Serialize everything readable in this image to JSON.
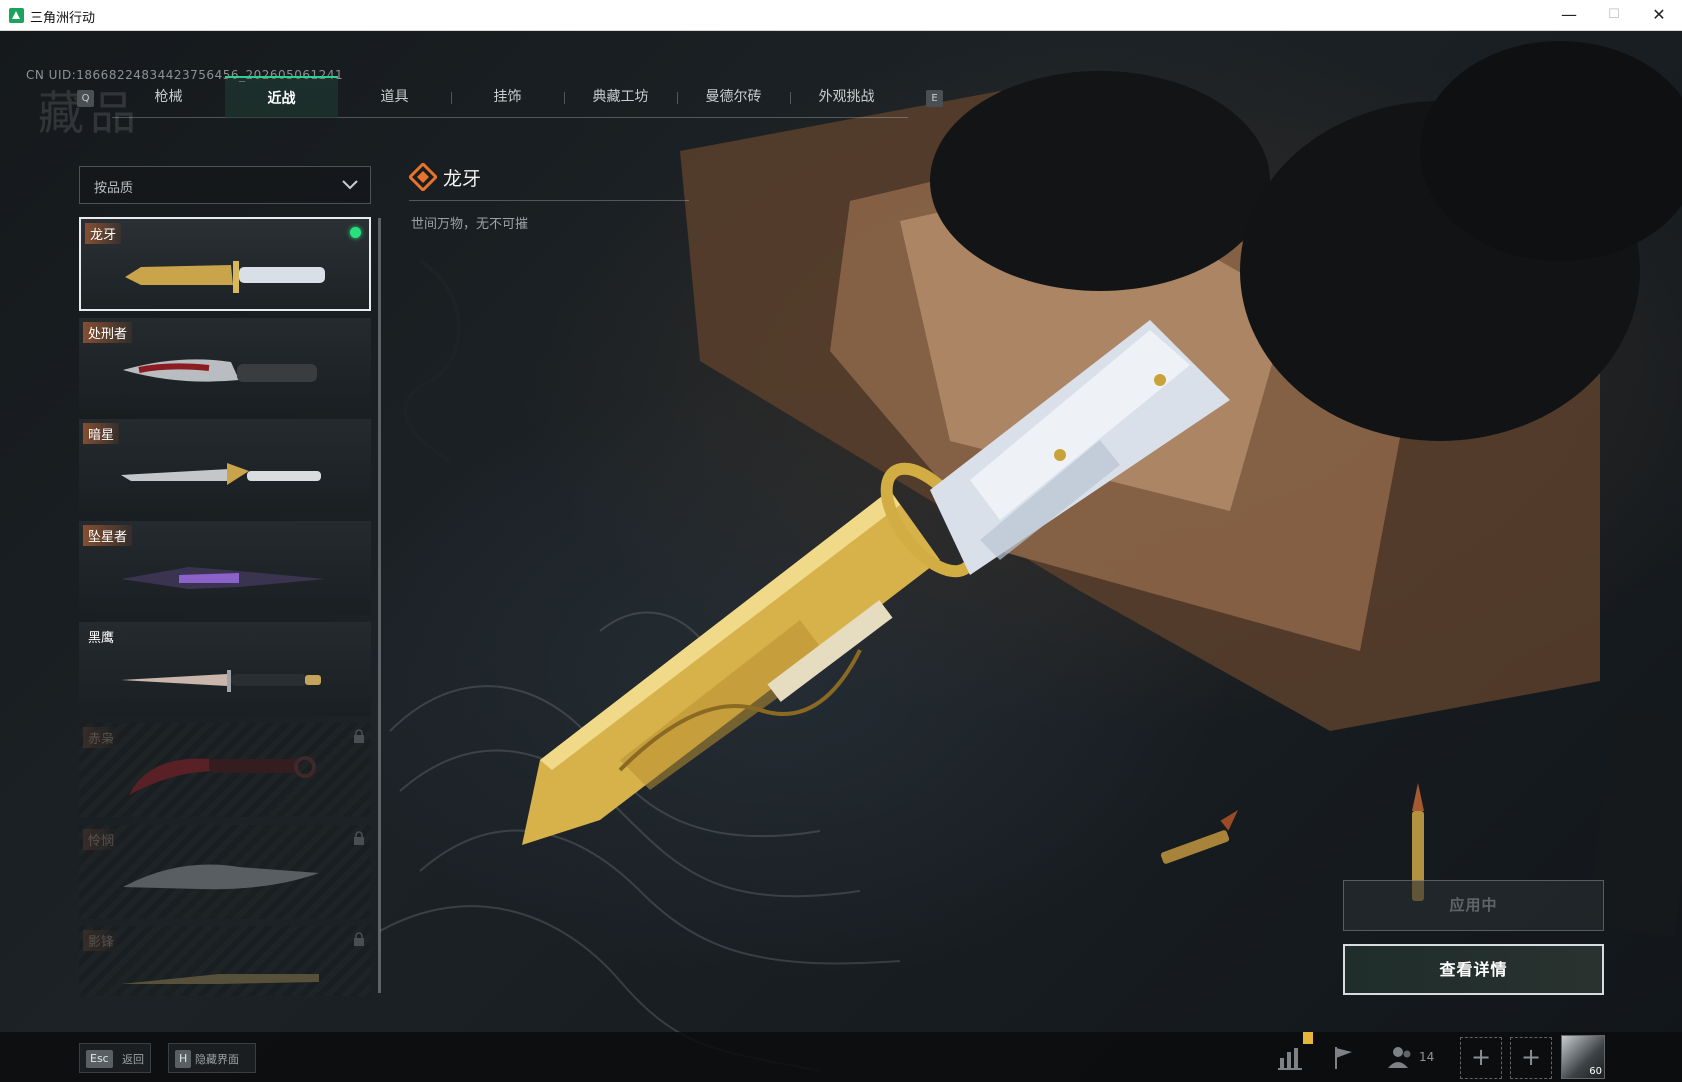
{
  "window": {
    "title": "三角洲行动",
    "minimize": "—",
    "maximize": "☐",
    "close": "✕"
  },
  "header": {
    "uid": "CN UID:18668224834423756456_202605061241",
    "section_title": "藏品",
    "prev_key": "Q",
    "next_key": "E"
  },
  "tabs": [
    {
      "label": "枪械",
      "active": false
    },
    {
      "label": "近战",
      "active": true
    },
    {
      "label": "道具",
      "active": false
    },
    {
      "label": "挂饰",
      "active": false
    },
    {
      "label": "典藏工坊",
      "active": false
    },
    {
      "label": "曼德尔砖",
      "active": false
    },
    {
      "label": "外观挑战",
      "active": false
    }
  ],
  "filter": {
    "label": "按品质",
    "icon": "chevron-down-icon"
  },
  "items": [
    {
      "name": "龙牙",
      "selected": true,
      "equipped": true,
      "locked": false
    },
    {
      "name": "处刑者",
      "selected": false,
      "equipped": false,
      "locked": false
    },
    {
      "name": "暗星",
      "selected": false,
      "equipped": false,
      "locked": false
    },
    {
      "name": "坠星者",
      "selected": false,
      "equipped": false,
      "locked": false
    },
    {
      "name": "黑鹰",
      "selected": false,
      "equipped": false,
      "locked": false
    },
    {
      "name": "赤枭",
      "selected": false,
      "equipped": false,
      "locked": true
    },
    {
      "name": "怜悯",
      "selected": false,
      "equipped": false,
      "locked": true
    },
    {
      "name": "影锋",
      "selected": false,
      "equipped": false,
      "locked": true
    }
  ],
  "detail": {
    "name": "龙牙",
    "description": "世间万物，无不可摧",
    "rarity_color": "#e8732a"
  },
  "actions": {
    "apply_label": "应用中",
    "details_label": "查看详情"
  },
  "bottom": {
    "back_key": "Esc",
    "back_label": "返回",
    "hide_key": "H",
    "hide_label": "隐藏界面",
    "friend_count": "14",
    "avatar_level": "60",
    "plus": "+"
  },
  "colors": {
    "accent": "#2fd08b",
    "equipped": "#29e07f",
    "gold": "#d4b24a"
  }
}
